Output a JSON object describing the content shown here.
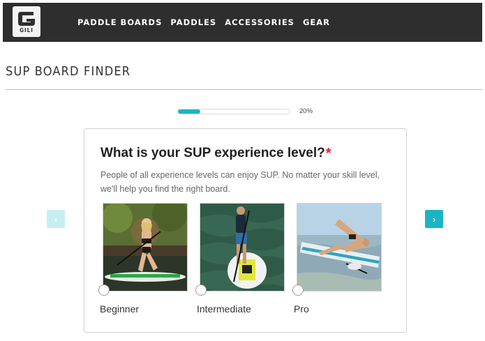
{
  "brand": {
    "logo_text": "GILI"
  },
  "nav": {
    "items": [
      "PADDLE BOARDS",
      "PADDLES",
      "ACCESSORIES",
      "GEAR"
    ]
  },
  "page": {
    "title": "SUP BOARD FINDER"
  },
  "progress": {
    "percent": 20,
    "label": "20%"
  },
  "question": {
    "title": "What is your SUP experience level?",
    "required_mark": "*",
    "description": "People of all experience levels can enjoy SUP. No matter your skill level, we'll help you find the right board.",
    "options": [
      {
        "label": "Beginner",
        "selected": false
      },
      {
        "label": "Intermediate",
        "selected": false
      },
      {
        "label": "Pro",
        "selected": false
      }
    ]
  },
  "arrows": {
    "prev": "‹",
    "next": "›"
  },
  "colors": {
    "accent": "#19b5c6",
    "accent_disabled": "#c6eef2",
    "header_bg": "#2e2e2e",
    "required": "#e02020"
  }
}
